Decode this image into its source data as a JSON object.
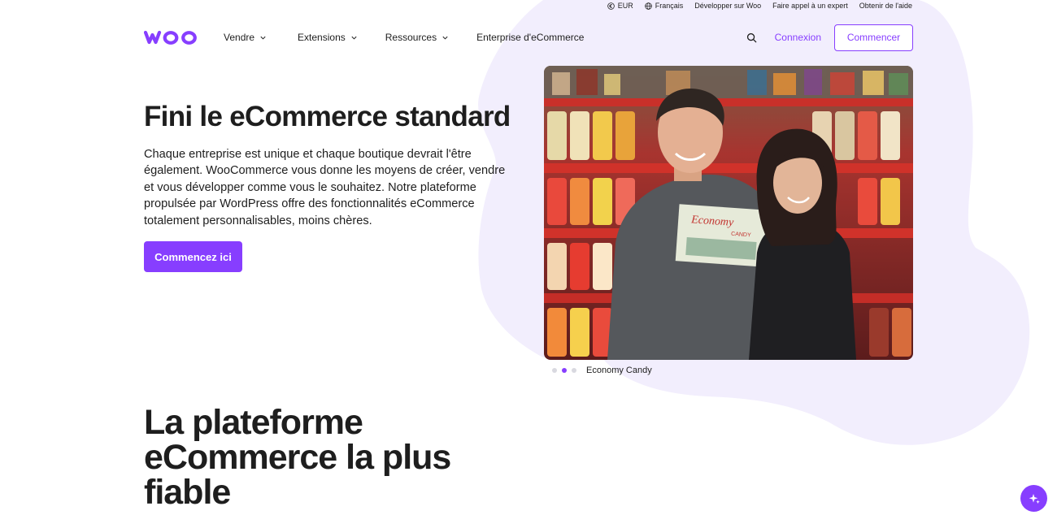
{
  "utility_bar": {
    "currency": "EUR",
    "language": "Français",
    "developers": "Développer sur Woo",
    "hire_expert": "Faire appel à un expert",
    "get_help": "Obtenir de l'aide"
  },
  "nav": {
    "logo_text": "woo",
    "links": [
      "Vendre",
      "Extensions",
      "Ressources",
      "Enterprise d'eCommerce"
    ],
    "login": "Connexion",
    "start": "Commencer"
  },
  "hero": {
    "title": "Fini le eCommerce standard",
    "text": "Chaque entreprise est unique et chaque boutique devrait l'être également. WooCommerce vous donne les moyens de créer, vendre et vous développer comme vous le souhaitez. Notre plateforme propulsée par WordPress offre des fonctionnalités eCommerce totalement personnalisables, moins chères.",
    "cta": "Commencez ici",
    "photo_shirt_text": "Economy",
    "photo_shirt_subtext": "CANDY"
  },
  "carousel": {
    "slide_count": 3,
    "active_index": 1,
    "caption": "Economy Candy"
  },
  "section": {
    "title": "La plateforme eCommerce la plus fiable"
  },
  "colors": {
    "brand": "#873eff",
    "blob": "#f2eefd",
    "text": "#1e1e1e"
  },
  "icons": {
    "currency": "euro-icon",
    "language": "globe-icon",
    "search": "search-icon",
    "chevron": "chevron-down-icon",
    "assistant": "sparkle-icon"
  }
}
